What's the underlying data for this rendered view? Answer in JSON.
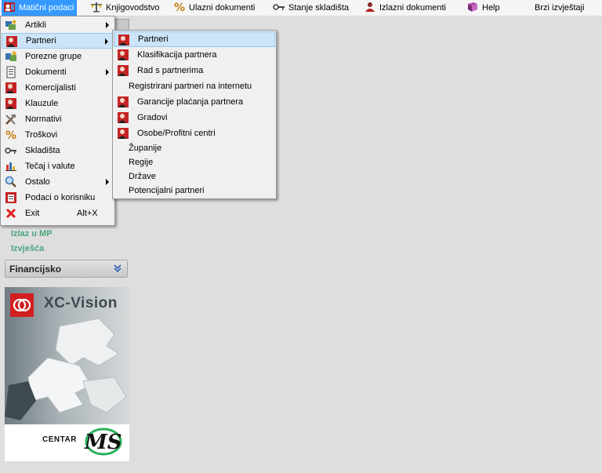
{
  "menubar": {
    "items": [
      {
        "label": "Matični podaci",
        "icon": "people-book-icon"
      },
      {
        "label": "Knjigovodstvo",
        "icon": "scales-icon"
      },
      {
        "label": "Ulazni dokumenti",
        "icon": "percent-icon"
      },
      {
        "label": "Stanje skladišta",
        "icon": "key-icon"
      },
      {
        "label": "Izlazni dokumenti",
        "icon": "person-icon"
      },
      {
        "label": "Help",
        "icon": "book-icon"
      },
      {
        "label": "Brzi izvještaji",
        "icon": ""
      }
    ]
  },
  "dropdown": {
    "items": [
      {
        "label": "Artikli",
        "icon": "articles-icon",
        "submenu": true
      },
      {
        "label": "Partneri",
        "icon": "partners-icon",
        "submenu": true
      },
      {
        "label": "Porezne grupe",
        "icon": "tax-groups-icon",
        "submenu": false
      },
      {
        "label": "Dokumenti",
        "icon": "document-icon",
        "submenu": true
      },
      {
        "label": "Komercijalisti",
        "icon": "sales-people-icon",
        "submenu": false
      },
      {
        "label": "Klauzule",
        "icon": "clauses-icon",
        "submenu": false
      },
      {
        "label": "Normativi",
        "icon": "tools-icon",
        "submenu": false
      },
      {
        "label": "Troškovi",
        "icon": "percent-icon",
        "submenu": false
      },
      {
        "label": "Skladišta",
        "icon": "key-icon",
        "submenu": false
      },
      {
        "label": "Tečaj  i valute",
        "icon": "chart-icon",
        "submenu": false
      },
      {
        "label": "Ostalo",
        "icon": "magnifier-icon",
        "submenu": true
      },
      {
        "label": "Podaci o korisniku",
        "icon": "user-data-icon",
        "submenu": false
      },
      {
        "label": "Exit",
        "icon": "close-icon",
        "shortcut": "Alt+X",
        "submenu": false
      }
    ]
  },
  "submenu": {
    "items": [
      {
        "label": "Partneri",
        "icon": "partners-icon"
      },
      {
        "label": "Klasifikacija partnera",
        "icon": "partners-icon"
      },
      {
        "label": "Rad s partnerima",
        "icon": "partners-icon"
      },
      {
        "label": "Registrirani partneri na internetu",
        "icon": ""
      },
      {
        "label": "Garancije plaćanja partnera",
        "icon": "partners-icon"
      },
      {
        "label": "Gradovi",
        "icon": "partners-icon"
      },
      {
        "label": "Osobe/Profitni centri",
        "icon": "partners-icon"
      },
      {
        "label": "Županije",
        "icon": ""
      },
      {
        "label": "Regije",
        "icon": ""
      },
      {
        "label": "Države",
        "icon": ""
      },
      {
        "label": "Potencijalni partneri",
        "icon": ""
      }
    ]
  },
  "sidebar": {
    "links": [
      "Izlaz u MP",
      "Izvješća"
    ],
    "panel_title": "Financijsko"
  },
  "brand": {
    "product": "XC-Vision",
    "company_a": "CENTAR",
    "company_b": "MS"
  },
  "colors": {
    "menu_active": "#3399ff",
    "hover": "#cce4f7",
    "link_green": "#4aa57c"
  }
}
